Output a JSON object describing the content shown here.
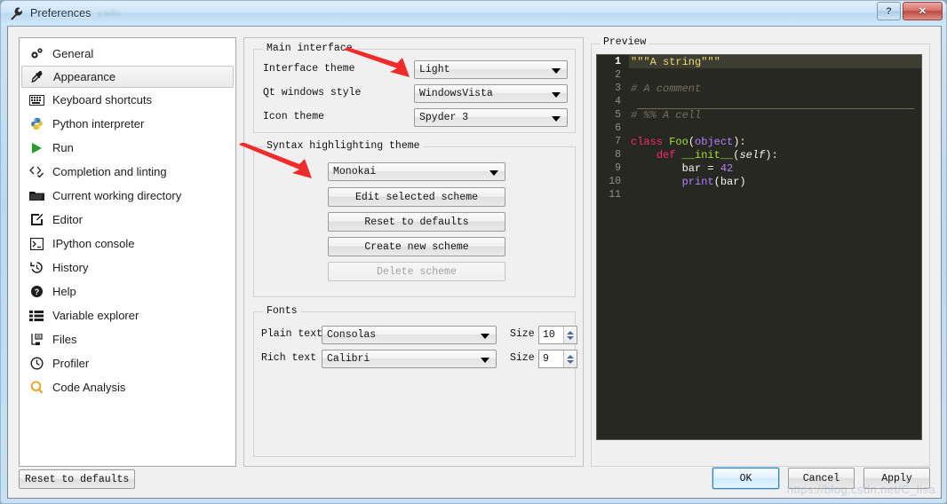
{
  "window": {
    "title": "Preferences",
    "title_icon": "wrench-icon",
    "title_watermark": "csdn",
    "help_button": "?",
    "close_button": "✕"
  },
  "sidebar": {
    "items": [
      {
        "label": "General",
        "icon": "gears-icon",
        "selected": false
      },
      {
        "label": "Appearance",
        "icon": "eyedropper-icon",
        "selected": true
      },
      {
        "label": "Keyboard shortcuts",
        "icon": "keyboard-icon",
        "selected": false
      },
      {
        "label": "Python interpreter",
        "icon": "python-icon",
        "selected": false
      },
      {
        "label": "Run",
        "icon": "play-icon",
        "selected": false
      },
      {
        "label": "Completion and linting",
        "icon": "code-check-icon",
        "selected": false
      },
      {
        "label": "Current working directory",
        "icon": "folder-icon",
        "selected": false
      },
      {
        "label": "Editor",
        "icon": "pencil-square-icon",
        "selected": false
      },
      {
        "label": "IPython console",
        "icon": "console-icon",
        "selected": false
      },
      {
        "label": "History",
        "icon": "history-icon",
        "selected": false
      },
      {
        "label": "Help",
        "icon": "question-circle-icon",
        "selected": false
      },
      {
        "label": "Variable explorer",
        "icon": "list-icon",
        "selected": false
      },
      {
        "label": "Files",
        "icon": "files-tree-icon",
        "selected": false
      },
      {
        "label": "Profiler",
        "icon": "clock-icon",
        "selected": false
      },
      {
        "label": "Code Analysis",
        "icon": "magnifier-q-icon",
        "selected": false
      }
    ]
  },
  "main_interface": {
    "group_title": "Main interface",
    "interface_theme": {
      "label": "Interface theme",
      "value": "Light"
    },
    "qt_windows_style": {
      "label": "Qt windows style",
      "value": "WindowsVista"
    },
    "icon_theme": {
      "label": "Icon theme",
      "value": "Spyder 3"
    }
  },
  "syntax_theme": {
    "group_title": "Syntax highlighting theme",
    "scheme_value": "Monokai",
    "edit_selected_scheme": "Edit selected scheme",
    "reset_to_defaults": "Reset to defaults",
    "create_new_scheme": "Create new scheme",
    "delete_scheme": "Delete scheme"
  },
  "fonts": {
    "group_title": "Fonts",
    "plain_text_label": "Plain text",
    "plain_text_value": "Consolas",
    "plain_size_label": "Size",
    "plain_size_value": "10",
    "rich_text_label": "Rich text",
    "rich_text_value": "Calibri",
    "rich_size_label": "Size",
    "rich_size_value": "9"
  },
  "preview": {
    "group_title": "Preview",
    "background_color": "#272822",
    "current_line_color": "#3e3d32",
    "line_numbers": [
      "1",
      "2",
      "3",
      "4",
      "5",
      "6",
      "7",
      "8",
      "9",
      "10",
      "11"
    ],
    "current_line": 1,
    "cell_separator_after_line": 4,
    "code": {
      "line1": "\"\"\"A string\"\"\"",
      "line3": "# A comment",
      "line5": "# %% A cell",
      "line7_kw": "class",
      "line7_name": " Foo",
      "line7_paren_open": "(",
      "line7_base": "object",
      "line7_tail": "):",
      "line8_kw": "def",
      "line8_name": " __init__",
      "line8_paren_open": "(",
      "line8_self": "self",
      "line8_tail": "):",
      "line9_var": "bar ",
      "line9_op": "= ",
      "line9_num": "42",
      "line10_fn": "print",
      "line10_args": "(bar)"
    },
    "colors": {
      "string": "#e6db74",
      "comment": "#75715e",
      "keyword": "#f92672",
      "definition": "#a6e22e",
      "number": "#ae81ff",
      "builtin": "#ae81ff",
      "normal": "#f8f8f2",
      "linenumber": "#8f908a"
    }
  },
  "footer": {
    "reset_to_defaults": "Reset to defaults",
    "ok": "OK",
    "cancel": "Cancel",
    "apply": "Apply",
    "watermark": "https://blog.csdn.net/C_lisa"
  }
}
